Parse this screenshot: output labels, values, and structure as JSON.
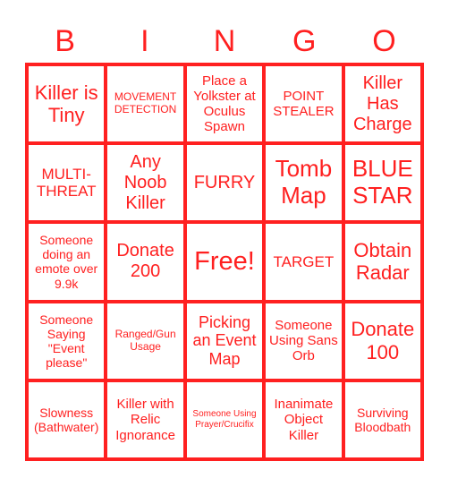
{
  "header": {
    "letters": [
      "B",
      "I",
      "N",
      "G",
      "O"
    ]
  },
  "theme": {
    "accent": "#ff2020",
    "background": "#ffffff"
  },
  "cells": [
    "Killer is Tiny",
    "MOVEMENT DETECTION",
    "Place a Yolkster at Oculus Spawn",
    "POINT STEALER",
    "Killer Has Charge",
    "MULTI-THREAT",
    "Any Noob Killer",
    "FURRY",
    "Tomb Map",
    "BLUE STAR",
    "Someone doing an emote over 9.9k",
    "Donate 200",
    "Free!",
    "TARGET",
    "Obtain Radar",
    "Someone Saying \"Event please\"",
    "Ranged/Gun Usage",
    "Picking an Event Map",
    "Someone Using Sans Orb",
    "Donate 100",
    "Slowness (Bathwater)",
    "Killer with Relic Ignorance",
    "Someone Using Prayer/Crucifix",
    "Inanimate Object Killer",
    "Surviving Bloodbath"
  ]
}
